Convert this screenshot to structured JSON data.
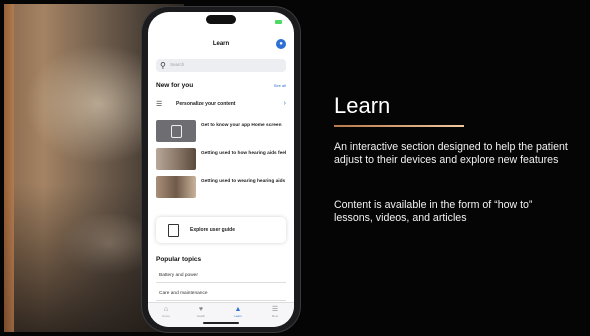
{
  "slide": {
    "title": "Learn",
    "paragraph1": "An interactive section designed to help the patient adjust to their devices and explore new features",
    "paragraph2": "Content is available in the form of “how to” lessons, videos, and articles",
    "accent_color": "#c8885a",
    "background_color": "#050505"
  },
  "app": {
    "header_title": "Learn",
    "mic_icon": "microphone-icon",
    "search": {
      "placeholder": "Search",
      "icon": "search-icon"
    },
    "new_for_you": {
      "heading": "New for you",
      "see_all": "See all",
      "personalize": "Personalize your content",
      "items": [
        {
          "label": "Get to know your app Home screen"
        },
        {
          "label": "Getting used to how hearing aids feel"
        },
        {
          "label": "Getting used to wearing hearing aids"
        }
      ]
    },
    "guide": {
      "label": "Explore user guide",
      "icon": "book-icon"
    },
    "popular_topics": {
      "heading": "Popular topics",
      "items": [
        {
          "label": "Battery and power"
        },
        {
          "label": "Care and maintenance"
        }
      ]
    },
    "tabs": [
      {
        "label": "Home",
        "icon": "home-icon",
        "active": false
      },
      {
        "label": "Health",
        "icon": "heart-icon",
        "active": false
      },
      {
        "label": "Learn",
        "icon": "graduation-cap-icon",
        "active": true
      },
      {
        "label": "More",
        "icon": "menu-icon",
        "active": false
      }
    ],
    "accent_color": "#2e6fd6"
  }
}
